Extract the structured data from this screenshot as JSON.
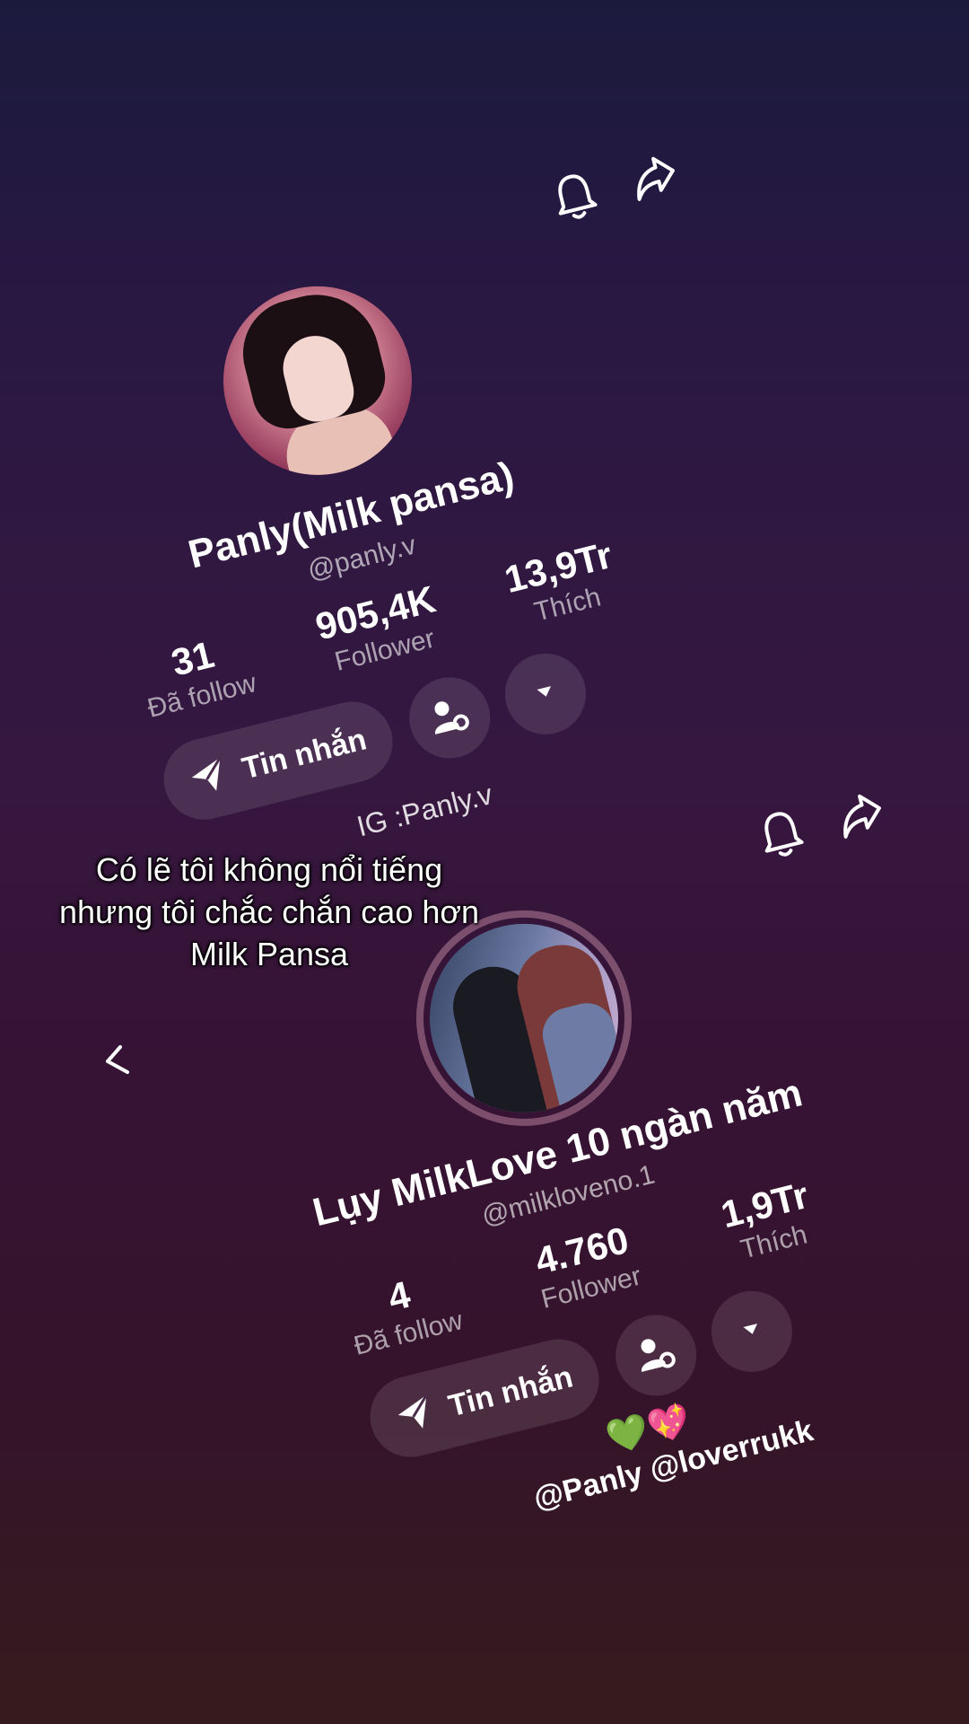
{
  "header_icons": {
    "bell": "bell-icon",
    "share": "share-icon"
  },
  "profile_1": {
    "name": "Panly(Milk pansa)",
    "handle": "@panly.v",
    "stats": [
      {
        "value": "31",
        "label": "Đã follow"
      },
      {
        "value": "905,4K",
        "label": "Follower"
      },
      {
        "value": "13,9Tr",
        "label": "Thích"
      }
    ],
    "message_label": "Tin nhắn",
    "bio": "IG :Panly.v"
  },
  "profile_2": {
    "name": "Lụy MilkLove 10 ngàn năm",
    "handle": "@milkloveno.1",
    "stats": [
      {
        "value": "4",
        "label": "Đã follow"
      },
      {
        "value": "4.760",
        "label": "Follower"
      },
      {
        "value": "1,9Tr",
        "label": "Thích"
      }
    ],
    "message_label": "Tin nhắn",
    "bio_emoji": "💚💖",
    "bio": "@Panly @loverrukk"
  },
  "caption_lines": [
    "Có lẽ tôi không nổi tiếng",
    "nhưng tôi chắc chắn cao hơn",
    "Milk Pansa"
  ]
}
